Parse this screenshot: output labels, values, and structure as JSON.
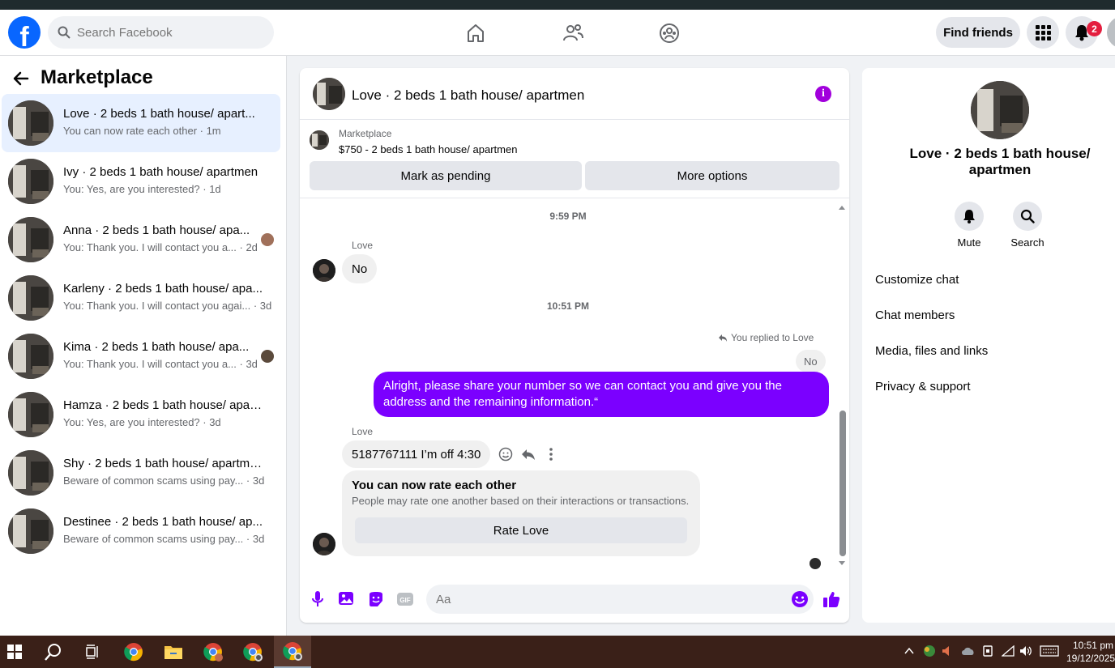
{
  "header": {
    "search_placeholder": "Search Facebook",
    "find_friends": "Find friends",
    "notif_count": "2"
  },
  "sidebar": {
    "title": "Marketplace",
    "conversations": [
      {
        "name": "Love · 2 beds 1 bath house/ apart...",
        "sub": "You can now rate each other · 1m",
        "active": true
      },
      {
        "name": "Ivy · 2 beds 1 bath house/ apartmen",
        "sub": "You: Yes, are you interested? · 1d"
      },
      {
        "name": "Anna · 2 beds 1 bath house/ apa...",
        "sub": "You: Thank you. I will contact you a... · 2d"
      },
      {
        "name": "Karleny · 2 beds 1 bath house/ apa...",
        "sub": "You: Thank you. I will contact you agai... · 3d"
      },
      {
        "name": "Kima · 2 beds 1 bath house/ apa...",
        "sub": "You: Thank you. I will contact you a... · 3d"
      },
      {
        "name": "Hamza · 2 beds 1 bath house/ apar...",
        "sub": "You: Yes, are you interested? · 3d"
      },
      {
        "name": "Shy · 2 beds 1 bath house/ apartmen",
        "sub": "Beware of common scams using pay... · 3d"
      },
      {
        "name": "Destinee · 2 beds 1 bath house/ ap...",
        "sub": "Beware of common scams using pay... · 3d"
      }
    ]
  },
  "chat": {
    "title": "Love · 2 beds 1 bath house/ apartmen",
    "listing_label": "Marketplace",
    "listing_price": "$750 - 2 beds 1 bath house/ apartmen",
    "mark_pending": "Mark as pending",
    "more_options": "More options",
    "time1": "9:59 PM",
    "sender1": "Love",
    "msg1": "No",
    "time2": "10:51 PM",
    "replied_label": "You replied to Love",
    "quoted": "No",
    "msg_out": "Alright, please share your number so we can contact you and give you the address and the remaining information.“",
    "sender2": "Love",
    "msg2": "5187767111 I’m off 4:30",
    "rate_title": "You can now rate each other",
    "rate_desc": "People may rate one another based on their interactions or transactions.",
    "rate_button": "Rate Love",
    "input_placeholder": "Aa"
  },
  "details": {
    "name": "Love · 2 beds 1 bath house/ apartmen",
    "mute": "Mute",
    "search": "Search",
    "rows": [
      "Customize chat",
      "Chat members",
      "Media, files and links",
      "Privacy & support"
    ]
  },
  "taskbar": {
    "time": "10:51 pm",
    "date": "19/12/2025"
  },
  "colors": {
    "accent": "#7b00ff",
    "fb_blue": "#0866ff",
    "info_purple": "#a100dc"
  }
}
